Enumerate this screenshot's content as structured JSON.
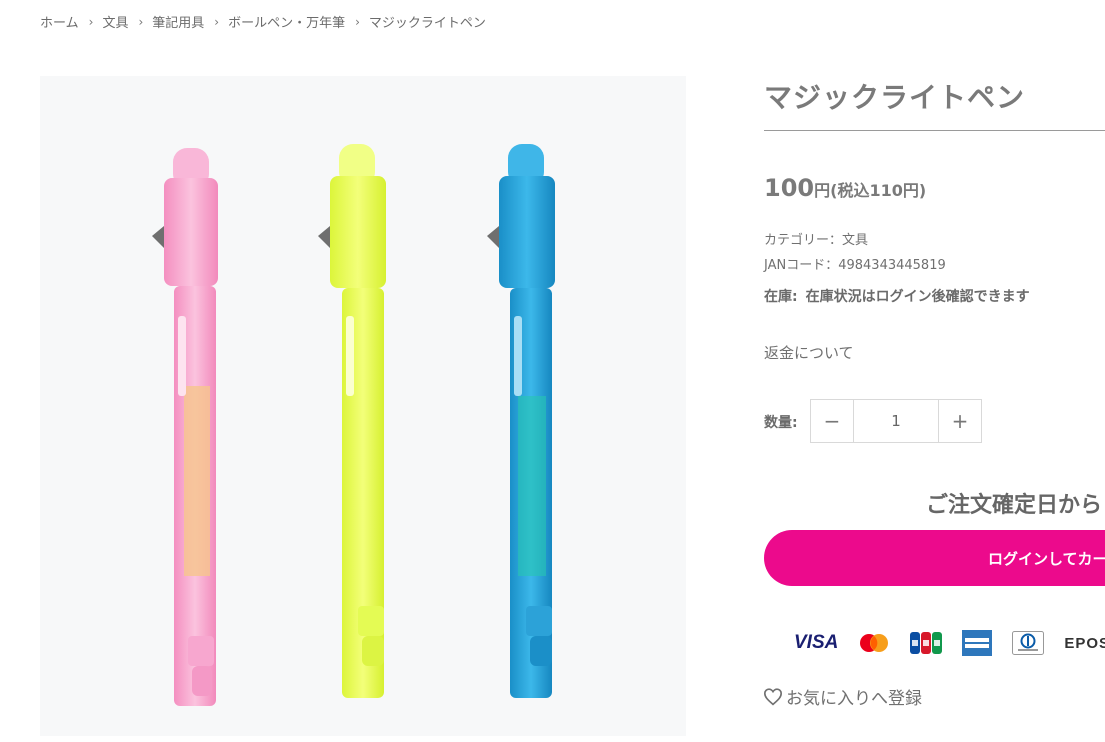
{
  "breadcrumb": [
    "ホーム",
    "文具",
    "筆記用具",
    "ボールペン・万年筆",
    "マジックライトペン"
  ],
  "product": {
    "title": "マジックライトペン",
    "price_amount": "100",
    "price_yen": "円",
    "price_tax": "(税込110円)",
    "category": "カテゴリー：文具",
    "jan": "JANコード：4984343445819",
    "stock_label": "在庫:",
    "stock_value": "在庫状況はログイン後確認できます",
    "refund_link": "返金について"
  },
  "quantity": {
    "label": "数量:",
    "value": "1",
    "minus": "−",
    "plus": "+"
  },
  "notice": "ご注文確定日から",
  "cart_button": "ログインしてカー",
  "payments": {
    "visa": "VISA",
    "epos": "EPOS",
    "icons": [
      "visa-icon",
      "mastercard-icon",
      "jcb-icon",
      "amex-icon",
      "diners-club-icon",
      "epos-icon"
    ]
  },
  "favorite": "お気に入りへ登録",
  "colors": {
    "accent": "#ec0a8c",
    "pen_pink": "#f9a8cf",
    "pen_yellow": "#eaff4a",
    "pen_blue": "#2aa7dc"
  }
}
